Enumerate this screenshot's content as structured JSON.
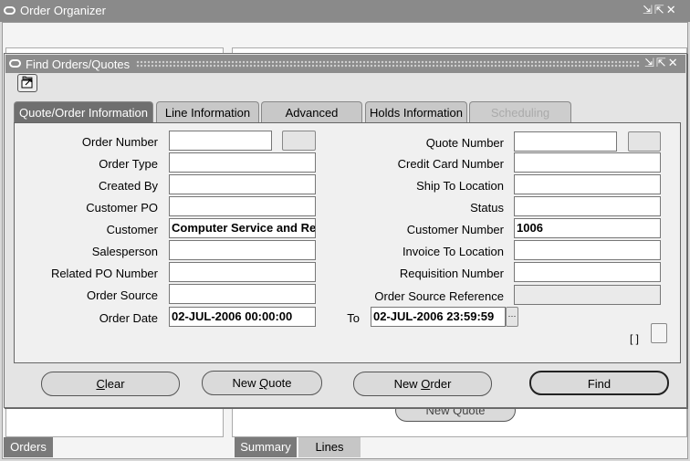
{
  "outer": {
    "title": "Order Organizer",
    "controls": "⇲⇱✕"
  },
  "background": {
    "new_quote_label": "New Quote",
    "left_tab": "Orders",
    "right_tabs": [
      "Summary",
      "Lines"
    ]
  },
  "dialog": {
    "title": "Find  Orders/Quotes",
    "controls": "⇲⇱✕",
    "tabs": [
      {
        "label": "Quote/Order Information",
        "state": "active"
      },
      {
        "label": "Line Information",
        "state": "normal"
      },
      {
        "label": "Advanced",
        "state": "normal"
      },
      {
        "label": "Holds Information",
        "state": "normal"
      },
      {
        "label": "Scheduling",
        "state": "disabled"
      }
    ],
    "left_fields": [
      {
        "label": "Order Number",
        "value": ""
      },
      {
        "label": "Order Type",
        "value": ""
      },
      {
        "label": "Created By",
        "value": ""
      },
      {
        "label": "Customer PO",
        "value": ""
      },
      {
        "label": "Customer",
        "value": "Computer Service and Re"
      },
      {
        "label": "Salesperson",
        "value": ""
      },
      {
        "label": "Related PO Number",
        "value": ""
      },
      {
        "label": "Order Source",
        "value": ""
      },
      {
        "label": "Order Date",
        "value": "02-JUL-2006 00:00:00"
      }
    ],
    "right_fields": [
      {
        "label": "Quote Number",
        "value": ""
      },
      {
        "label": "Credit Card Number",
        "value": ""
      },
      {
        "label": "Ship To Location",
        "value": ""
      },
      {
        "label": "Status",
        "value": ""
      },
      {
        "label": "Customer Number",
        "value": "1006"
      },
      {
        "label": "Invoice To Location",
        "value": ""
      },
      {
        "label": "Requisition Number",
        "value": ""
      },
      {
        "label": "Order Source Reference",
        "value": ""
      }
    ],
    "to_label": "To",
    "to_value": "02-JUL-2006 23:59:59",
    "lov_button": "···",
    "flex_bracket": "[ ]",
    "buttons": {
      "clear_pre": "",
      "clear_key": "C",
      "clear_post": "lear",
      "newquote_pre": "New ",
      "newquote_key": "Q",
      "newquote_post": "uote",
      "neworder_pre": "New ",
      "neworder_key": "O",
      "neworder_post": "rder",
      "find": "Find"
    }
  }
}
